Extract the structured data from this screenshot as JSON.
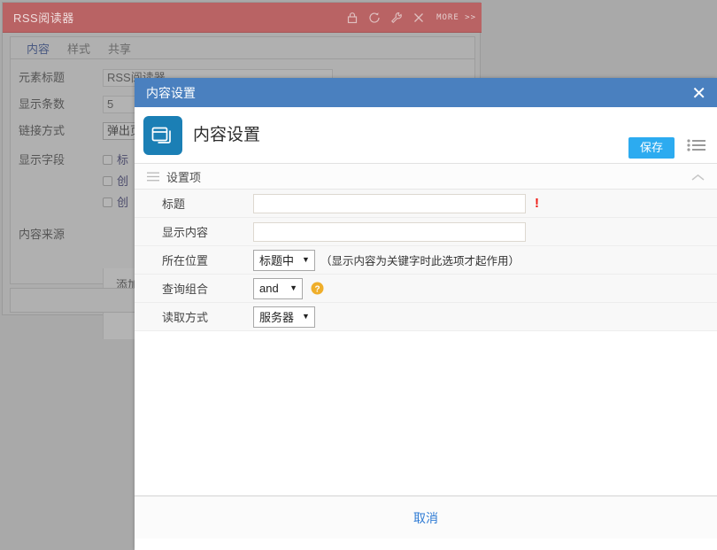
{
  "background_window": {
    "title": "RSS阅读器",
    "titlebar_color": "#b96364",
    "icons": [
      {
        "name": "lock-icon",
        "label": "锁定"
      },
      {
        "name": "refresh-icon",
        "label": "刷新"
      },
      {
        "name": "wrench-icon",
        "label": "设置"
      },
      {
        "name": "close-icon",
        "label": "关闭"
      }
    ],
    "more_label": "MORE >>",
    "tabs": [
      {
        "label": "内容",
        "active": true
      },
      {
        "label": "样式",
        "active": false
      },
      {
        "label": "共享",
        "active": false
      }
    ],
    "fields": [
      {
        "label": "元素标题",
        "value": "RSS阅读器"
      },
      {
        "label": "显示条数",
        "value": "5"
      },
      {
        "label": "链接方式",
        "value": "弹出页"
      },
      {
        "label": "显示字段",
        "value": ""
      },
      {
        "label": "内容来源",
        "value": ""
      }
    ],
    "checkboxes": [
      {
        "label": "标",
        "checked": false
      },
      {
        "label": "创",
        "checked": false
      },
      {
        "label": "创",
        "checked": false
      }
    ],
    "add_label": "添加"
  },
  "modal": {
    "titlebar_title": "内容设置",
    "titlebar_color": "#4a80bf",
    "close_icon": "close-icon",
    "app_title": "内容设置",
    "app_icon": "window-stack-icon",
    "app_icon_color": "#1b7fb5",
    "save_label": "保存",
    "save_color": "#2cabf0",
    "list_icon": "list-icon",
    "section": {
      "hamburger_icon": "hamburger-icon",
      "title": "设置项",
      "collapse_icon": "chevron-up-icon"
    },
    "rows": [
      {
        "label": "标题",
        "type": "text",
        "value": "",
        "placeholder": "",
        "required": true,
        "required_mark": "!"
      },
      {
        "label": "显示内容",
        "type": "text",
        "value": "",
        "placeholder": "",
        "required": false
      },
      {
        "label": "所在位置",
        "type": "select",
        "value": "标题中",
        "caret": "▼",
        "hint": "（显示内容为关键字时此选项才起作用）"
      },
      {
        "label": "查询组合",
        "type": "select",
        "value": "and",
        "caret": "▼",
        "help_icon": "question-help-icon"
      },
      {
        "label": "读取方式",
        "type": "select",
        "value": "服务器",
        "caret": "▼"
      }
    ],
    "footer": {
      "cancel_label": "取消",
      "cancel_color": "#2f7bd4"
    }
  }
}
